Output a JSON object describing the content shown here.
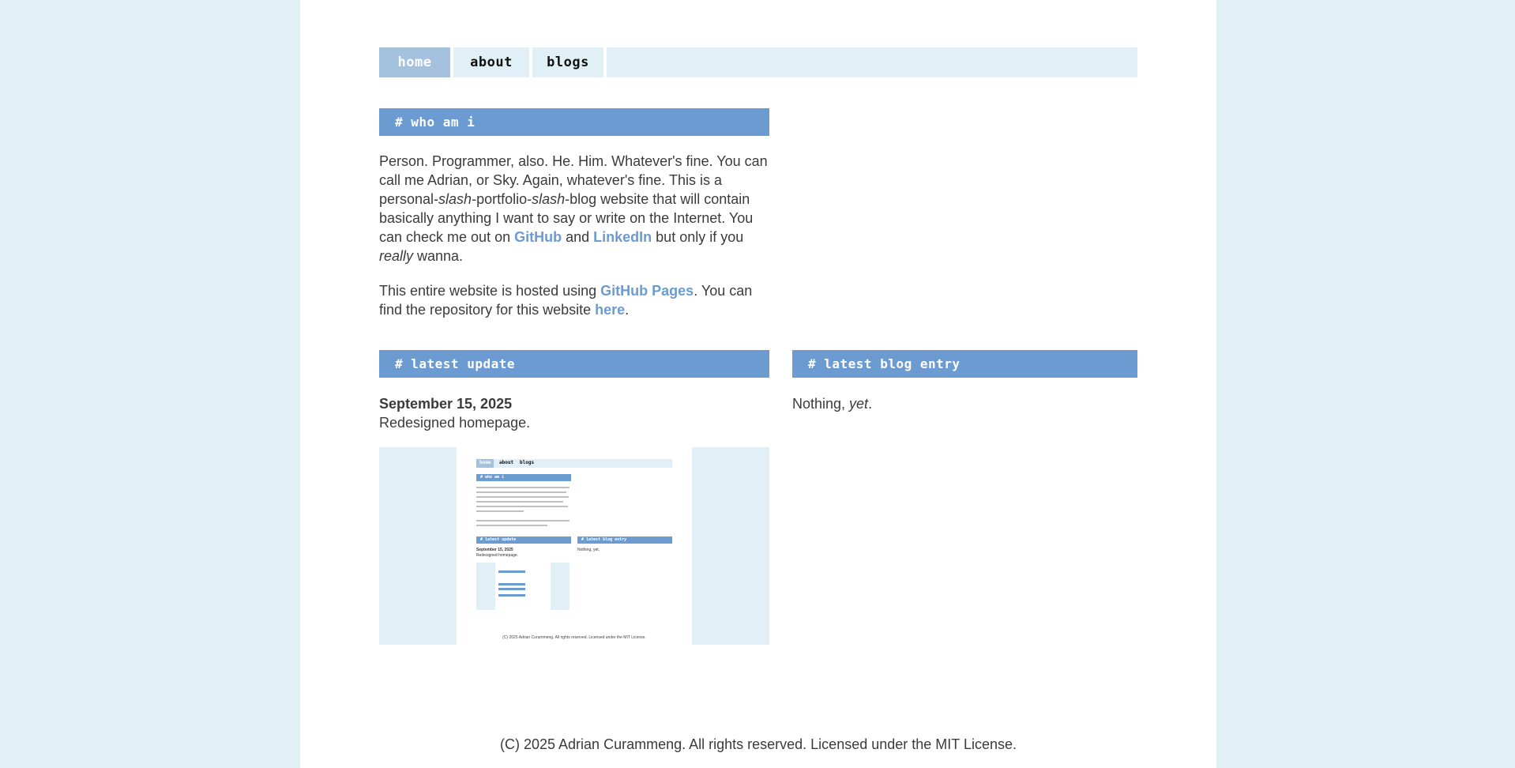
{
  "nav": {
    "items": [
      {
        "label": "home",
        "active": true
      },
      {
        "label": "about",
        "active": false
      },
      {
        "label": "blogs",
        "active": false
      }
    ]
  },
  "who": {
    "heading": "# who am i",
    "p1_a": "Person. Programmer, also. He. Him. Whatever's fine. You can call me Adrian, or Sky. Again, whatever's fine. This is a personal-",
    "p1_slash1": "slash",
    "p1_b": "-portfolio-",
    "p1_slash2": "slash",
    "p1_c": "-blog website that will contain basically anything I want to say or write on the Internet. You can check me out on ",
    "p1_github": "GitHub",
    "p1_and": " and ",
    "p1_linkedin": "LinkedIn",
    "p1_d": " but only if you ",
    "p1_really": "really",
    "p1_e": " wanna.",
    "p2_a": "This entire website is hosted using ",
    "p2_pages": "GitHub Pages",
    "p2_b": ". You can find the repository for this website ",
    "p2_here": "here",
    "p2_c": "."
  },
  "latest_update": {
    "heading": "# latest update",
    "date": "September 15, 2025",
    "text": "Redesigned homepage."
  },
  "latest_blog": {
    "heading": "# latest blog entry",
    "text_a": "Nothing, ",
    "text_yet": "yet",
    "text_b": "."
  },
  "preview": {
    "nav": [
      "home",
      "about",
      "blogs"
    ],
    "who_heading": "# who am i",
    "update_heading": "# latest update",
    "blog_heading": "# latest blog entry",
    "date": "September 15, 2025",
    "update_text": "Redesigned homepage.",
    "blog_text": "Nothing, yet.",
    "footer": "(C) 2025 Adrian Curammeng. All rights reserved. Licensed under the MIT License."
  },
  "footer": {
    "text": "(C) 2025 Adrian Curammeng. All rights reserved. Licensed under the MIT License."
  },
  "colors": {
    "background": "#e1eff6",
    "accent": "#6b9bd1",
    "nav_active": "#a4c2de",
    "text": "#3b3b3b"
  }
}
